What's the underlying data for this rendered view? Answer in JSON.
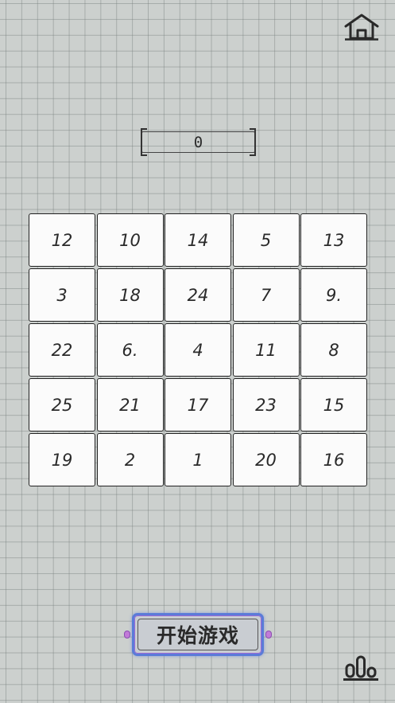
{
  "header": {
    "home_icon": "home-icon"
  },
  "score": {
    "value": "0"
  },
  "board": {
    "tiles": [
      "12",
      "10",
      "14",
      "5",
      "13",
      "3",
      "18",
      "24",
      "7",
      "9.",
      "22",
      "6.",
      "4",
      "11",
      "8",
      "25",
      "21",
      "17",
      "23",
      "15",
      "19",
      "2",
      "1",
      "20",
      "16"
    ]
  },
  "start_button": {
    "label": "开始游戏",
    "border_color": "#5b7bd8"
  },
  "footer": {
    "leaderboard_icon": "leaderboard-icon"
  }
}
